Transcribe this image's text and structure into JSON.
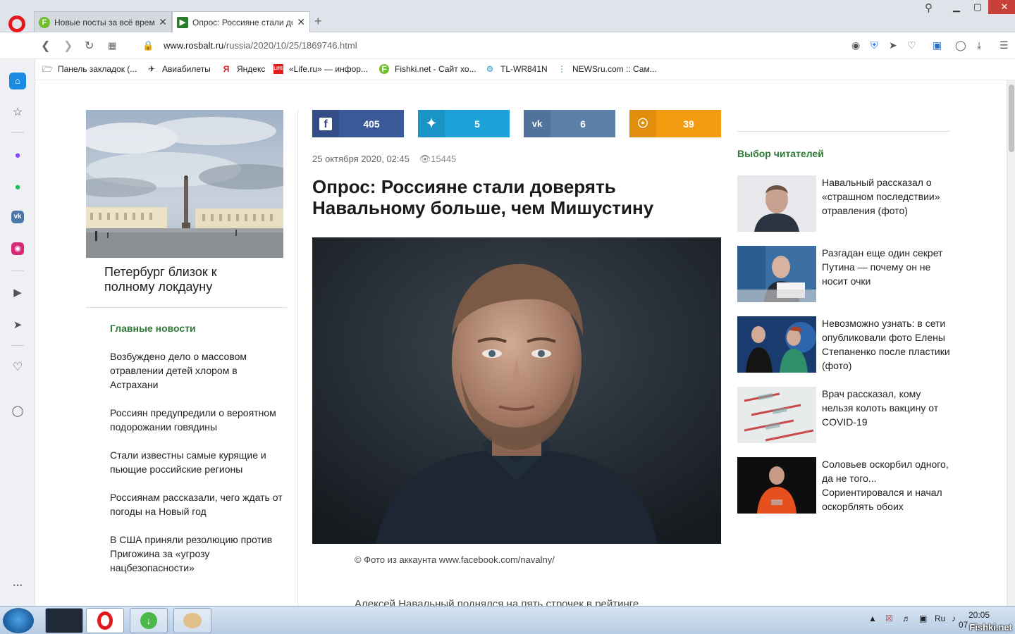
{
  "browser": {
    "tabs": [
      {
        "title": "Новые посты за всё время",
        "active": false
      },
      {
        "title": "Опрос: Россияне стали доверять Навальному",
        "active": true
      }
    ],
    "url_host": "www.rosbalt.ru",
    "url_path": "/russia/2020/10/25/1869746.html",
    "bookmarks": [
      {
        "label": "Панель закладок (...",
        "icon": "folder-icon"
      },
      {
        "label": "Авиабилеты",
        "icon": "plane-icon"
      },
      {
        "label": "Яндекс",
        "icon": "yandex-icon"
      },
      {
        "label": "«Life.ru» — инфор...",
        "icon": "life-icon"
      },
      {
        "label": "Fishki.net - Сайт хо...",
        "icon": "fishki-icon"
      },
      {
        "label": "TL-WR841N",
        "icon": "tplink-icon"
      },
      {
        "label": "NEWSru.com :: Сам...",
        "icon": "newsru-icon"
      }
    ],
    "sidebar_icons": [
      "home-icon",
      "star-icon",
      "messenger-icon",
      "whatsapp-icon",
      "vk-icon",
      "instagram-icon",
      "player-icon",
      "send-icon",
      "heart-icon",
      "bulb-icon",
      "more-icon"
    ]
  },
  "page": {
    "featured": {
      "title": "Петербург близок к полному локдауну"
    },
    "main_news_heading": "Главные новости",
    "main_news": [
      "Возбуждено дело о массовом отравлении детей хлором в Астрахани",
      "Россиян предупредили о вероятном подорожании говядины",
      "Стали известны самые курящие и пьющие российские регионы",
      "Россиянам рассказали, чего ждать от погоды на Новый год",
      "В США приняли резолюцию против Пригожина за «угрозу нацбезопасности»"
    ],
    "share": [
      {
        "network": "facebook",
        "count": "405",
        "color": "#3b5998",
        "dark": "#334d86"
      },
      {
        "network": "twitter",
        "count": "5",
        "color": "#1da1d8",
        "dark": "#1a93c6"
      },
      {
        "network": "vk",
        "count": "6",
        "color": "#5b7fa6",
        "dark": "#51729a"
      },
      {
        "network": "odnoklassniki",
        "count": "39",
        "color": "#f39c12",
        "dark": "#e08e0b"
      }
    ],
    "date": "25 октября 2020, 02:45",
    "views": "15445",
    "headline": "Опрос: Россияне стали доверять Навальному больше, чем Мишустину",
    "caption": "© Фото из аккаунта www.facebook.com/navalny/",
    "body_start": "Алексей Навальный поднялся на пять строчек в рейтинге",
    "readers_choice_heading": "Выбор читателей",
    "readers_choice": [
      "Навальный рассказал о «страшном последствии» отравления (фото)",
      "Разгадан еще один секрет Путина — почему он не носит очки",
      "Невозможно узнать: в сети опубликовали фото Елены Степаненко после пластики (фото)",
      "Врач рассказал, кому нельзя колоть вакцину от COVID-19",
      "Соловьев оскорбил одного, да не того... Сориентировался и начал оскорблять обоих"
    ]
  },
  "taskbar": {
    "lang": "Ru",
    "time": "20:05",
    "date_partial": "07",
    "watermark": "Fishki.net"
  }
}
